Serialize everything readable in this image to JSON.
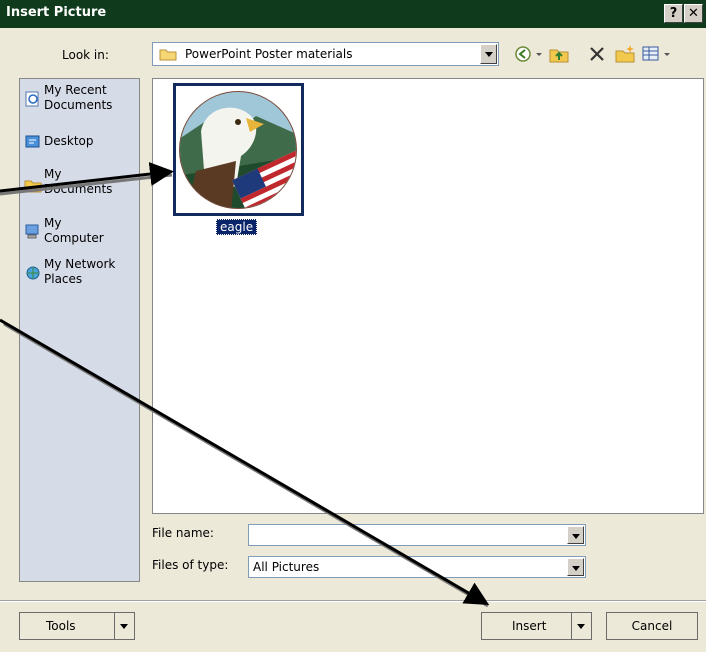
{
  "window": {
    "title": "Insert Picture",
    "help_label": "?",
    "close_label": "✕",
    "title_bar_color": "#0f3b1c"
  },
  "lookin": {
    "label": "Look in:",
    "value": "PowerPoint Poster materials"
  },
  "toolbar_icons": [
    "back-icon",
    "dropdown-arrow-icon",
    "up-folder-icon",
    "delete-icon",
    "new-folder-icon",
    "views-icon"
  ],
  "places": [
    {
      "label_1": "My Recent",
      "label_2": "Documents",
      "icon": "recent-documents-icon"
    },
    {
      "label_1": "Desktop",
      "label_2": "",
      "icon": "desktop-icon"
    },
    {
      "label_1": "My",
      "label_2": "Documents",
      "icon": "my-documents-icon"
    },
    {
      "label_1": "My",
      "label_2": "Computer",
      "icon": "my-computer-icon"
    },
    {
      "label_1": "My Network",
      "label_2": "Places",
      "icon": "network-places-icon"
    }
  ],
  "files": [
    {
      "name": "eagle",
      "selected": true
    }
  ],
  "filename": {
    "label": "File name:",
    "value": ""
  },
  "filetype": {
    "label": "Files of type:",
    "value": "All Pictures"
  },
  "buttons": {
    "tools": "Tools",
    "insert": "Insert",
    "cancel": "Cancel"
  }
}
